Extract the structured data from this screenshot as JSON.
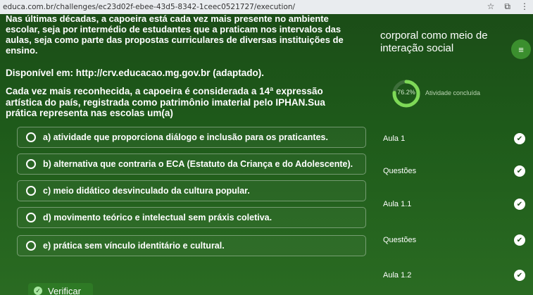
{
  "browser": {
    "url": "educa.com.br/challenges/ec23d02f-ebee-43d5-8342-1ceec0521727/execution/",
    "star_icon": "star-icon",
    "extensions_icon": "puzzle-icon",
    "menu_icon": "kebab-icon"
  },
  "question": {
    "top_text": "Nas últimas décadas, a capoeira está cada vez mais presente no ambiente escolar, seja por intermédio de estudantes que a praticam nos intervalos das aulas, seja como parte das propostas curriculares de diversas instituições de ensino.",
    "source": "Disponível em: http://crv.educacao.mg.gov.br (adaptado).",
    "statement": "Cada vez mais reconhecida, a capoeira é considerada a 14ª expressão artística do país, registrada como patrimônio imaterial pelo IPHAN.Sua prática representa nas escolas um(a)"
  },
  "options": [
    {
      "label": "a) atividade que proporciona diálogo e inclusão para os praticantes."
    },
    {
      "label": "b) alternativa que contraria o ECA (Estatuto da Criança e do Adolescente)."
    },
    {
      "label": "c) meio didático desvinculado da cultura popular."
    },
    {
      "label": "d) movimento teórico e intelectual sem práxis coletiva."
    },
    {
      "label": "e) prática sem vínculo identitário e cultural."
    }
  ],
  "verify_label": "Verificar",
  "sidebar": {
    "title": "corporal como meio de interação social",
    "menu_icon": "hamburger-icon",
    "progress": {
      "value": 0.762,
      "label": "76.2%",
      "caption": "Atividade concluída"
    },
    "lessons": [
      {
        "label": "Aula 1",
        "done": true
      },
      {
        "label": "Questões",
        "done": true
      },
      {
        "label": "Aula 1.1",
        "done": true
      },
      {
        "label": "Questões",
        "done": true
      },
      {
        "label": "Aula 1.2",
        "done": true
      }
    ]
  },
  "colors": {
    "background": "#1f4f1a",
    "accent": "#3b8f2e",
    "progress": "#7ed957"
  }
}
